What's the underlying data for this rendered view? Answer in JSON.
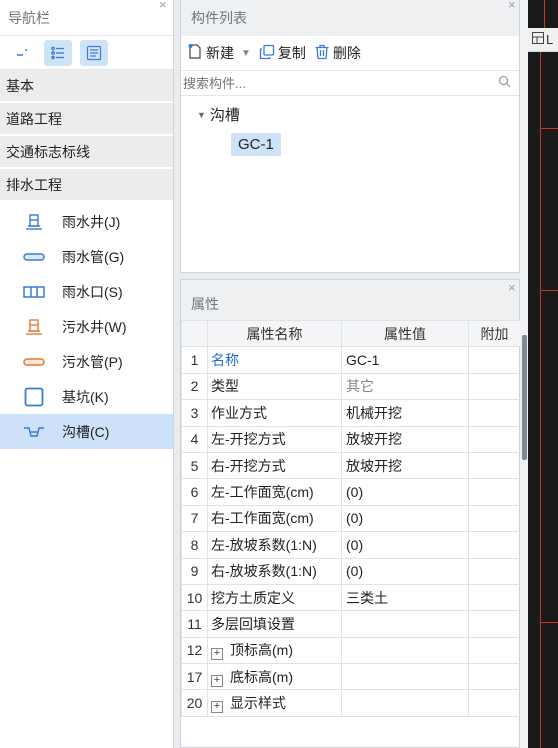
{
  "nav": {
    "title": "导航栏",
    "categories": [
      "基本",
      "道路工程",
      "交通标志标线",
      "排水工程"
    ],
    "items": [
      {
        "label": "雨水井(J)",
        "icon": "rain-well-icon"
      },
      {
        "label": "雨水管(G)",
        "icon": "rain-pipe-icon"
      },
      {
        "label": "雨水口(S)",
        "icon": "rain-inlet-icon"
      },
      {
        "label": "污水井(W)",
        "icon": "sewage-well-icon"
      },
      {
        "label": "污水管(P)",
        "icon": "sewage-pipe-icon"
      },
      {
        "label": "基坑(K)",
        "icon": "pit-icon"
      },
      {
        "label": "沟槽(C)",
        "icon": "trench-icon"
      }
    ],
    "active_index": 6
  },
  "components": {
    "title": "构件列表",
    "toolbar": {
      "new": "新建",
      "copy": "复制",
      "delete": "删除"
    },
    "search_placeholder": "搜索构件...",
    "tree": {
      "group": "沟槽",
      "leaf": "GC-1"
    }
  },
  "properties": {
    "title": "属性",
    "headers": {
      "num": "",
      "name": "属性名称",
      "value": "属性值",
      "extra": "附加"
    },
    "rows": [
      {
        "num": "1",
        "name": "名称",
        "value": "GC-1"
      },
      {
        "num": "2",
        "name": "类型",
        "value": "其它"
      },
      {
        "num": "3",
        "name": "作业方式",
        "value": "机械开挖"
      },
      {
        "num": "4",
        "name": "左-开挖方式",
        "value": "放坡开挖"
      },
      {
        "num": "5",
        "name": "右-开挖方式",
        "value": "放坡开挖"
      },
      {
        "num": "6",
        "name": "左-工作面宽(cm)",
        "value": "(0)"
      },
      {
        "num": "7",
        "name": "右-工作面宽(cm)",
        "value": "(0)"
      },
      {
        "num": "8",
        "name": "左-放坡系数(1:N)",
        "value": "(0)"
      },
      {
        "num": "9",
        "name": "右-放坡系数(1:N)",
        "value": "(0)"
      },
      {
        "num": "10",
        "name": "挖方土质定义",
        "value": "三类土"
      },
      {
        "num": "11",
        "name": "多层回填设置",
        "value": ""
      },
      {
        "num": "12",
        "name": "顶标高(m)",
        "value": "",
        "expand": "+"
      },
      {
        "num": "17",
        "name": "底标高(m)",
        "value": "",
        "expand": "+"
      },
      {
        "num": "20",
        "name": "显示样式",
        "value": "",
        "expand": "+"
      }
    ]
  },
  "right_panel": {
    "tab_label": "L"
  }
}
